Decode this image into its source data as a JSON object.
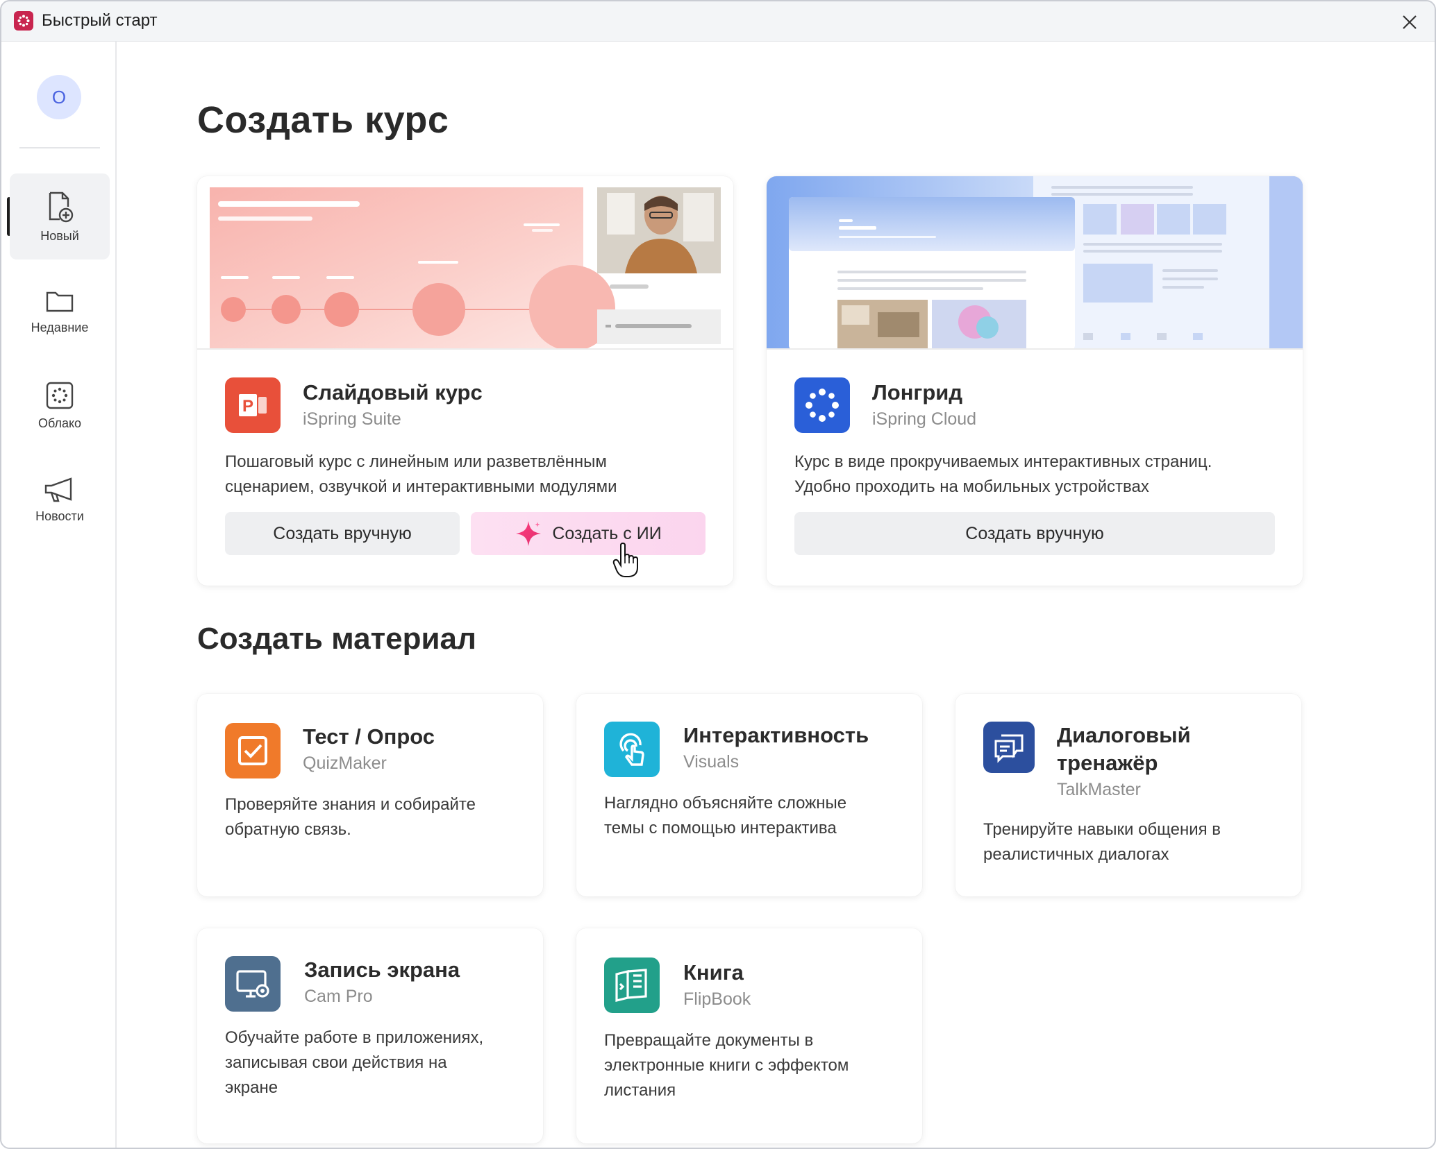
{
  "window": {
    "title": "Быстрый старт"
  },
  "sidebar": {
    "avatar_initial": "О",
    "items": [
      {
        "label": "Новый",
        "icon": "new-file-icon",
        "active": true
      },
      {
        "label": "Недавние",
        "icon": "folder-icon",
        "active": false
      },
      {
        "label": "Облако",
        "icon": "cloud-icon",
        "active": false
      },
      {
        "label": "Новости",
        "icon": "megaphone-icon",
        "active": false
      }
    ]
  },
  "course_section": {
    "heading": "Создать курс",
    "cards": [
      {
        "title": "Слайдовый курс",
        "subtitle": "iSpring Suite",
        "description": "Пошаговый курс с линейным или разветвлённым сценарием, озвучкой и интерактивными модулями",
        "description_lines": [
          "Пошаговый курс с линейным или разветвлённым",
          "сценарием, озвучкой и интерактивными модулями"
        ],
        "icon": "powerpoint-icon",
        "accent": "#e8503a",
        "buttons": {
          "manual": "Создать вручную",
          "ai": "Создать с ИИ"
        }
      },
      {
        "title": "Лонгрид",
        "subtitle": "iSpring Cloud",
        "description_lines": [
          "Курс в виде прокручиваемых интерактивных страниц.",
          "Удобно проходить на мобильных устройствах"
        ],
        "icon": "ispring-cloud-icon",
        "accent": "#2a5fd8",
        "buttons": {
          "manual": "Создать вручную"
        }
      }
    ]
  },
  "material_section": {
    "heading": "Создать материал",
    "cards": [
      {
        "title_lines": [
          "Тест / Опрос"
        ],
        "subtitle": "QuizMaker",
        "description_lines": [
          "Проверяйте знания и собирайте",
          "обратную связь."
        ],
        "icon": "quiz-checkbox-icon",
        "accent": "#f07a2a"
      },
      {
        "title_lines": [
          "Интерактивность"
        ],
        "subtitle": "Visuals",
        "description_lines": [
          "Наглядно объясняйте сложные",
          "темы с помощью интерактива"
        ],
        "icon": "touch-icon",
        "accent": "#1fb3d8"
      },
      {
        "title_lines": [
          "Диалоговый",
          "тренажёр"
        ],
        "subtitle": "TalkMaster",
        "description_lines": [
          "Тренируйте навыки общения в",
          "реалистичных диалогах"
        ],
        "icon": "chat-icon",
        "accent": "#2c4f9e"
      },
      {
        "title_lines": [
          "Запись экрана"
        ],
        "subtitle": "Cam Pro",
        "description_lines": [
          "Обучайте работе в приложениях,",
          "записывая свои действия на",
          "экране"
        ],
        "icon": "screen-record-icon",
        "accent": "#4f6f8f"
      },
      {
        "title_lines": [
          "Книга"
        ],
        "subtitle": "FlipBook",
        "description_lines": [
          "Превращайте документы в",
          "электронные книги с эффектом",
          "листания"
        ],
        "icon": "book-icon",
        "accent": "#22a08a"
      }
    ]
  }
}
